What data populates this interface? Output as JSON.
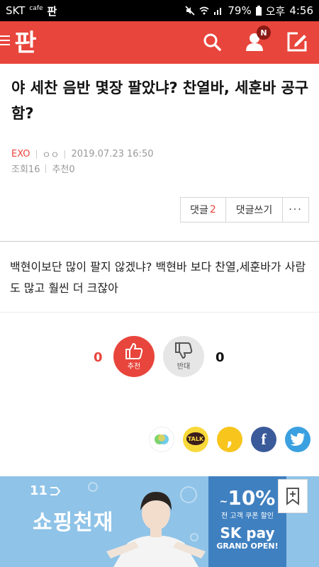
{
  "status_bar": {
    "carrier": "SKT",
    "cafe_label": "cafe",
    "pann_icon": "판",
    "battery": "79%",
    "ampm": "오후",
    "time": "4:56",
    "icons": [
      "mute-icon",
      "wifi-icon",
      "signal-icon",
      "battery-icon"
    ]
  },
  "app_bar": {
    "logo_text": "판",
    "notification_badge": "N",
    "accent_color": "#e8453c",
    "icons": [
      "menu-icon",
      "search-icon",
      "profile-icon",
      "write-icon"
    ]
  },
  "article": {
    "title": "야 세찬 음반 몇장 팔았냐? 찬열바, 세훈바 공구 함?",
    "category": "EXO",
    "author": "ㅇㅇ",
    "date": "2019.07.23 16:50",
    "views_label": "조회",
    "views": "16",
    "recommend_label": "추천",
    "recommend": "0",
    "body": "백현이보단 많이 팔지 않겠냐? 백현바 보다 찬열,세훈바가 사람도 많고 훨씬 더 크잖아"
  },
  "actions": {
    "comments_label": "댓글",
    "comments_count": "2",
    "write_comment_label": "댓글쓰기",
    "more_label": "···"
  },
  "vote": {
    "up_count": "0",
    "up_label": "추천",
    "down_count": "0",
    "down_label": "반대"
  },
  "share": {
    "talk_label": "TALK",
    "story_label": ",",
    "fb_label": "f",
    "icons": [
      "band-icon",
      "kakaotalk-icon",
      "kakaostory-icon",
      "facebook-icon",
      "twitter-icon"
    ]
  },
  "banner": {
    "brand": "11",
    "slogan": "쇼핑천재",
    "discount_prefix": "~",
    "discount": "10%",
    "coupon_text": "전 고객 쿠폰 할인",
    "pay_name": "SK pay",
    "grand_open": "GRAND OPEN!"
  }
}
